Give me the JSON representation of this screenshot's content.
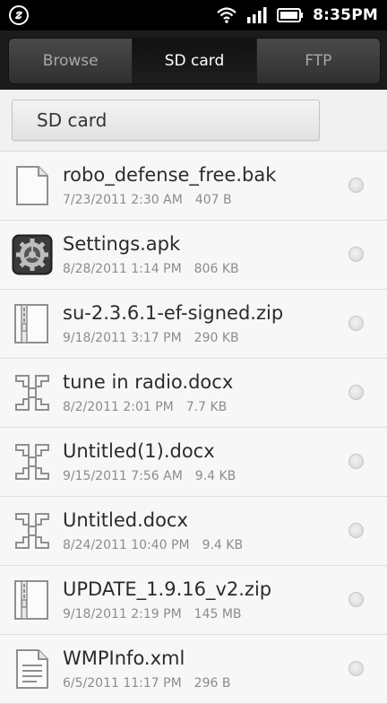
{
  "status_bar": {
    "time": "8:35PM",
    "icons": [
      "link-icon",
      "wifi-icon",
      "signal-icon",
      "battery-icon"
    ]
  },
  "tabs": [
    {
      "label": "Browse",
      "active": false
    },
    {
      "label": "SD card",
      "active": true
    },
    {
      "label": "FTP",
      "active": false
    }
  ],
  "path": {
    "label": "SD card"
  },
  "files": [
    {
      "name": "robo_defense_free.bak",
      "date": "7/23/2011 2:30 AM",
      "size": "407 B",
      "icon": "file-icon"
    },
    {
      "name": "Settings.apk",
      "date": "8/28/2011 1:14 PM",
      "size": "806 KB",
      "icon": "settings-gear-icon"
    },
    {
      "name": "su-2.3.6.1-ef-signed.zip",
      "date": "9/18/2011 3:17 PM",
      "size": "290 KB",
      "icon": "zip-icon"
    },
    {
      "name": "tune in radio.docx",
      "date": "8/2/2011 2:01 PM",
      "size": "7.7 KB",
      "icon": "docx-icon"
    },
    {
      "name": "Untitled(1).docx",
      "date": "9/15/2011 7:56 AM",
      "size": "9.4 KB",
      "icon": "docx-icon"
    },
    {
      "name": "Untitled.docx",
      "date": "8/24/2011 10:40 PM",
      "size": "9.4 KB",
      "icon": "docx-icon"
    },
    {
      "name": "UPDATE_1.9.16_v2.zip",
      "date": "9/18/2011 2:19 PM",
      "size": "145 MB",
      "icon": "zip-icon"
    },
    {
      "name": "WMPInfo.xml",
      "date": "6/5/2011 11:17 PM",
      "size": "296 B",
      "icon": "text-document-icon"
    }
  ]
}
